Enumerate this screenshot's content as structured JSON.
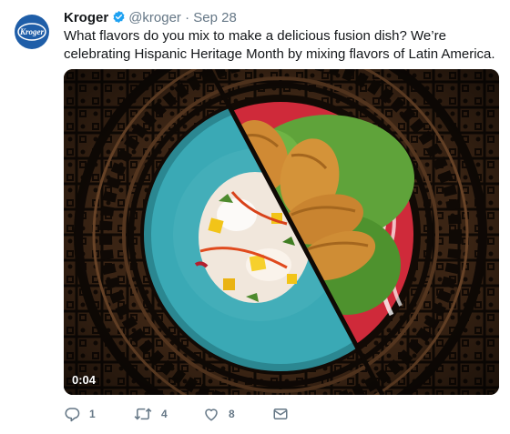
{
  "tweet": {
    "avatar_text": "Kroger",
    "author_name": "Kroger",
    "handle": "@kroger",
    "separator": "·",
    "date": "Sep 28",
    "text": "What flavors do you mix to make a delicious fusion dish? We’re celebrating Hispanic Heritage Month by mixing flavors of Latin America.",
    "media": {
      "timestamp": "0:04"
    },
    "actions": {
      "reply_count": "1",
      "retweet_count": "4",
      "like_count": "8"
    }
  },
  "colors": {
    "avatar_bg": "#1f5ea8",
    "verified_blue": "#1da1f2",
    "meta_gray": "#657786",
    "plate_teal": "#3aa9b5"
  },
  "icons": [
    "kroger-logo",
    "verified-badge-icon",
    "reply-icon",
    "retweet-icon",
    "like-icon",
    "dm-icon"
  ]
}
